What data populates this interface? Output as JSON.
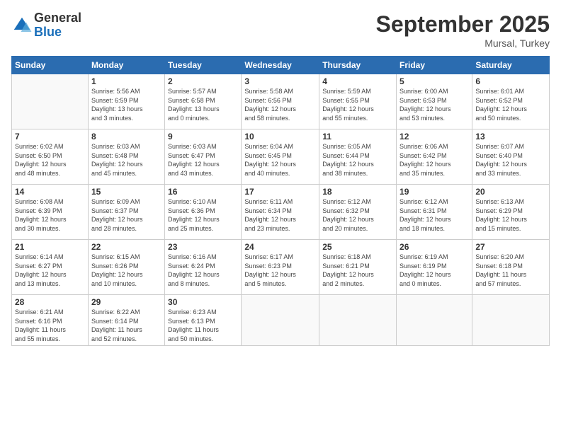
{
  "logo": {
    "general": "General",
    "blue": "Blue"
  },
  "header": {
    "month": "September 2025",
    "location": "Mursal, Turkey"
  },
  "weekdays": [
    "Sunday",
    "Monday",
    "Tuesday",
    "Wednesday",
    "Thursday",
    "Friday",
    "Saturday"
  ],
  "weeks": [
    [
      {
        "day": "",
        "info": ""
      },
      {
        "day": "1",
        "info": "Sunrise: 5:56 AM\nSunset: 6:59 PM\nDaylight: 13 hours\nand 3 minutes."
      },
      {
        "day": "2",
        "info": "Sunrise: 5:57 AM\nSunset: 6:58 PM\nDaylight: 13 hours\nand 0 minutes."
      },
      {
        "day": "3",
        "info": "Sunrise: 5:58 AM\nSunset: 6:56 PM\nDaylight: 12 hours\nand 58 minutes."
      },
      {
        "day": "4",
        "info": "Sunrise: 5:59 AM\nSunset: 6:55 PM\nDaylight: 12 hours\nand 55 minutes."
      },
      {
        "day": "5",
        "info": "Sunrise: 6:00 AM\nSunset: 6:53 PM\nDaylight: 12 hours\nand 53 minutes."
      },
      {
        "day": "6",
        "info": "Sunrise: 6:01 AM\nSunset: 6:52 PM\nDaylight: 12 hours\nand 50 minutes."
      }
    ],
    [
      {
        "day": "7",
        "info": "Sunrise: 6:02 AM\nSunset: 6:50 PM\nDaylight: 12 hours\nand 48 minutes."
      },
      {
        "day": "8",
        "info": "Sunrise: 6:03 AM\nSunset: 6:48 PM\nDaylight: 12 hours\nand 45 minutes."
      },
      {
        "day": "9",
        "info": "Sunrise: 6:03 AM\nSunset: 6:47 PM\nDaylight: 12 hours\nand 43 minutes."
      },
      {
        "day": "10",
        "info": "Sunrise: 6:04 AM\nSunset: 6:45 PM\nDaylight: 12 hours\nand 40 minutes."
      },
      {
        "day": "11",
        "info": "Sunrise: 6:05 AM\nSunset: 6:44 PM\nDaylight: 12 hours\nand 38 minutes."
      },
      {
        "day": "12",
        "info": "Sunrise: 6:06 AM\nSunset: 6:42 PM\nDaylight: 12 hours\nand 35 minutes."
      },
      {
        "day": "13",
        "info": "Sunrise: 6:07 AM\nSunset: 6:40 PM\nDaylight: 12 hours\nand 33 minutes."
      }
    ],
    [
      {
        "day": "14",
        "info": "Sunrise: 6:08 AM\nSunset: 6:39 PM\nDaylight: 12 hours\nand 30 minutes."
      },
      {
        "day": "15",
        "info": "Sunrise: 6:09 AM\nSunset: 6:37 PM\nDaylight: 12 hours\nand 28 minutes."
      },
      {
        "day": "16",
        "info": "Sunrise: 6:10 AM\nSunset: 6:36 PM\nDaylight: 12 hours\nand 25 minutes."
      },
      {
        "day": "17",
        "info": "Sunrise: 6:11 AM\nSunset: 6:34 PM\nDaylight: 12 hours\nand 23 minutes."
      },
      {
        "day": "18",
        "info": "Sunrise: 6:12 AM\nSunset: 6:32 PM\nDaylight: 12 hours\nand 20 minutes."
      },
      {
        "day": "19",
        "info": "Sunrise: 6:12 AM\nSunset: 6:31 PM\nDaylight: 12 hours\nand 18 minutes."
      },
      {
        "day": "20",
        "info": "Sunrise: 6:13 AM\nSunset: 6:29 PM\nDaylight: 12 hours\nand 15 minutes."
      }
    ],
    [
      {
        "day": "21",
        "info": "Sunrise: 6:14 AM\nSunset: 6:27 PM\nDaylight: 12 hours\nand 13 minutes."
      },
      {
        "day": "22",
        "info": "Sunrise: 6:15 AM\nSunset: 6:26 PM\nDaylight: 12 hours\nand 10 minutes."
      },
      {
        "day": "23",
        "info": "Sunrise: 6:16 AM\nSunset: 6:24 PM\nDaylight: 12 hours\nand 8 minutes."
      },
      {
        "day": "24",
        "info": "Sunrise: 6:17 AM\nSunset: 6:23 PM\nDaylight: 12 hours\nand 5 minutes."
      },
      {
        "day": "25",
        "info": "Sunrise: 6:18 AM\nSunset: 6:21 PM\nDaylight: 12 hours\nand 2 minutes."
      },
      {
        "day": "26",
        "info": "Sunrise: 6:19 AM\nSunset: 6:19 PM\nDaylight: 12 hours\nand 0 minutes."
      },
      {
        "day": "27",
        "info": "Sunrise: 6:20 AM\nSunset: 6:18 PM\nDaylight: 11 hours\nand 57 minutes."
      }
    ],
    [
      {
        "day": "28",
        "info": "Sunrise: 6:21 AM\nSunset: 6:16 PM\nDaylight: 11 hours\nand 55 minutes."
      },
      {
        "day": "29",
        "info": "Sunrise: 6:22 AM\nSunset: 6:14 PM\nDaylight: 11 hours\nand 52 minutes."
      },
      {
        "day": "30",
        "info": "Sunrise: 6:23 AM\nSunset: 6:13 PM\nDaylight: 11 hours\nand 50 minutes."
      },
      {
        "day": "",
        "info": ""
      },
      {
        "day": "",
        "info": ""
      },
      {
        "day": "",
        "info": ""
      },
      {
        "day": "",
        "info": ""
      }
    ]
  ]
}
